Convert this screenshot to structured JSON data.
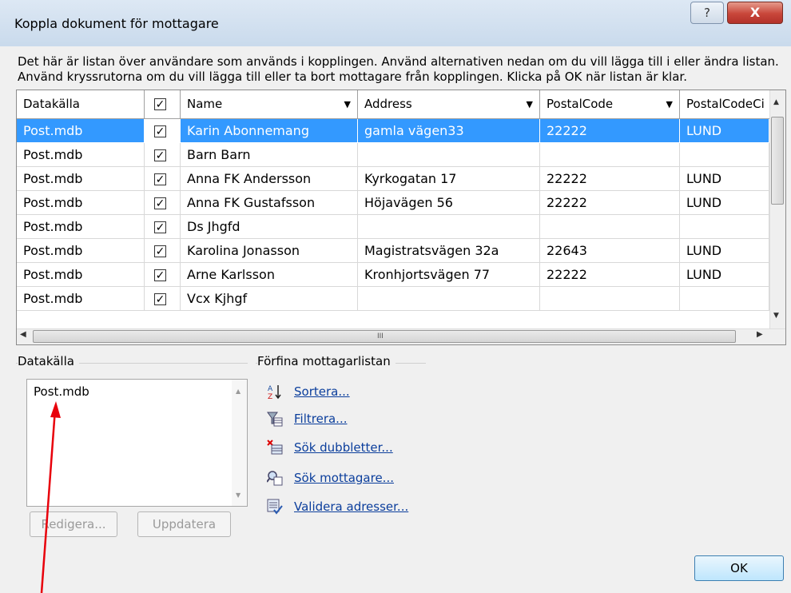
{
  "window": {
    "title": "Koppla dokument för mottagare",
    "help_glyph": "?",
    "close_glyph": "X"
  },
  "description": {
    "line1": "Det här är listan över användare som används i kopplingen. Använd alternativen nedan om du vill lägga till i eller ändra listan.",
    "line2": "Använd kryssrutorna om du vill lägga till eller ta bort mottagare från kopplingen. Klicka på OK när listan är klar."
  },
  "grid": {
    "columns": [
      "Datakälla",
      "",
      "Name",
      "Address",
      "PostalCode",
      "PostalCodeCi"
    ],
    "dropdown_glyph": "▼",
    "check_glyph": "✓",
    "rows": [
      {
        "source": "Post.mdb",
        "checked": "✓",
        "name": "Karin Abonnemang",
        "address": "gamla vägen33",
        "postal": "22222",
        "city": "LUND",
        "selected": true
      },
      {
        "source": "Post.mdb",
        "checked": "✓",
        "name": "Barn Barn",
        "address": "",
        "postal": "",
        "city": ""
      },
      {
        "source": "Post.mdb",
        "checked": "✓",
        "name": "Anna FK Andersson",
        "address": "Kyrkogatan 17",
        "postal": "22222",
        "city": "LUND"
      },
      {
        "source": "Post.mdb",
        "checked": "✓",
        "name": "Anna FK Gustafsson",
        "address": "Höjavägen 56",
        "postal": "22222",
        "city": "LUND"
      },
      {
        "source": "Post.mdb",
        "checked": "✓",
        "name": "Ds Jhgfd",
        "address": "",
        "postal": "",
        "city": ""
      },
      {
        "source": "Post.mdb",
        "checked": "✓",
        "name": "Karolina Jonasson",
        "address": "Magistratsvägen 32a",
        "postal": "22643",
        "city": "LUND"
      },
      {
        "source": "Post.mdb",
        "checked": "✓",
        "name": "Arne Karlsson",
        "address": "Kronhjortsvägen 77",
        "postal": "22222",
        "city": "LUND"
      },
      {
        "source": "Post.mdb",
        "checked": "✓",
        "name": "Vcx Kjhgf",
        "address": "",
        "postal": "",
        "city": ""
      }
    ],
    "hscroll_mark": "III"
  },
  "datasource": {
    "label": "Datakälla",
    "items": [
      "Post.mdb"
    ],
    "edit_button": "Redigera...",
    "update_button": "Uppdatera"
  },
  "refine": {
    "label": "Förfina mottagarlistan",
    "links": [
      {
        "label": "Sortera...",
        "icon": "sort-az-icon"
      },
      {
        "label": "Filtrera...",
        "icon": "filter-icon"
      },
      {
        "label": "Sök dubbletter...",
        "icon": "find-duplicates-icon"
      },
      {
        "label": "Sök mottagare...",
        "icon": "find-recipient-icon"
      },
      {
        "label": "Validera adresser...",
        "icon": "validate-addresses-icon"
      }
    ]
  },
  "ok_button": "OK",
  "colors": {
    "selection": "#3399ff",
    "link": "#0b3e9c",
    "annotation_arrow": "#e8000b"
  }
}
